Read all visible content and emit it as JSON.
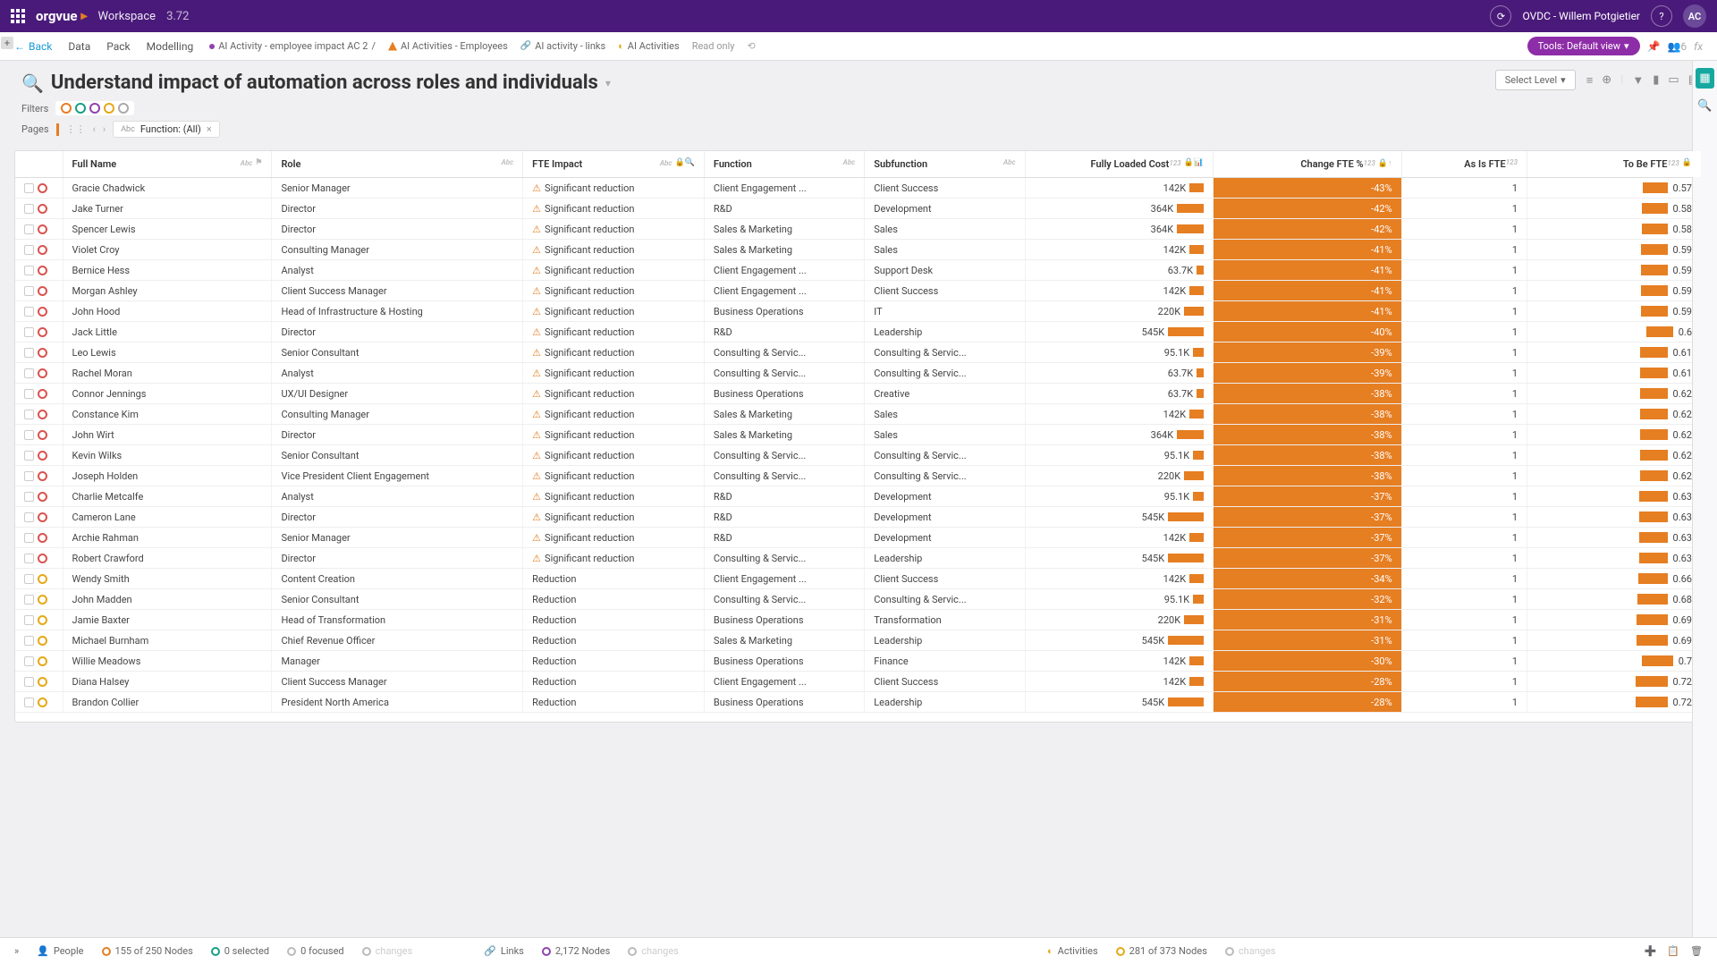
{
  "topbar": {
    "logo": "orgvue",
    "workspace": "Workspace",
    "version": "3.72",
    "user": "OVDC - Willem Potgietier",
    "avatar": "AC"
  },
  "nav": {
    "back": "Back",
    "tabs": [
      "Data",
      "Pack",
      "Modelling"
    ],
    "crumbs": [
      {
        "label": "AI Activity - employee impact AC 2",
        "cls": "purple"
      },
      {
        "label": "AI Activities - Employees",
        "cls": "orange"
      },
      {
        "label": "AI activity - links",
        "cls": "link"
      },
      {
        "label": "AI Activities",
        "cls": "yellow"
      }
    ],
    "readonly": "Read only",
    "tools": "Tools: Default view",
    "people_count": "6"
  },
  "page": {
    "title": "Understand impact of automation across roles and individuals",
    "filters_label": "Filters",
    "pages_label": "Pages",
    "pages_pill_abc": "Abc",
    "pages_pill": "Function: (All)",
    "select_level": "Select Level"
  },
  "columns": [
    {
      "label": "Full Name",
      "cls": "col-name",
      "type": "Abc",
      "icons": "⚑"
    },
    {
      "label": "Role",
      "cls": "col-role",
      "type": "Abc"
    },
    {
      "label": "FTE Impact",
      "cls": "col-fte",
      "type": "Abc",
      "icons": "🔒🔍"
    },
    {
      "label": "Function",
      "cls": "col-func",
      "type": "Abc"
    },
    {
      "label": "Subfunction",
      "cls": "col-subf",
      "type": "Abc"
    },
    {
      "label": "Fully Loaded Cost",
      "cls": "col-cost",
      "type": "123",
      "icons": "🔒📊"
    },
    {
      "label": "Change FTE %",
      "cls": "col-chg",
      "type": "123",
      "icons": "🔒↑"
    },
    {
      "label": "As Is FTE",
      "cls": "col-asis",
      "type": "123"
    },
    {
      "label": "To Be FTE",
      "cls": "col-tobe",
      "type": "123",
      "icons": "🔒"
    }
  ],
  "rows": [
    {
      "ring": "red",
      "name": "Gracie Chadwick",
      "role": "Senior Manager",
      "impact": "Significant reduction",
      "warn": true,
      "func": "Client Engagement ...",
      "subf": "Client Success",
      "cost": "142K",
      "chg": "-43%",
      "asis": "1",
      "tobe": "0.57"
    },
    {
      "ring": "red",
      "name": "Jake Turner",
      "role": "Director",
      "impact": "Significant reduction",
      "warn": true,
      "func": "R&D",
      "subf": "Development",
      "cost": "364K",
      "chg": "-42%",
      "asis": "1",
      "tobe": "0.58"
    },
    {
      "ring": "red",
      "name": "Spencer Lewis",
      "role": "Director",
      "impact": "Significant reduction",
      "warn": true,
      "func": "Sales & Marketing",
      "subf": "Sales",
      "cost": "364K",
      "chg": "-42%",
      "asis": "1",
      "tobe": "0.58"
    },
    {
      "ring": "red",
      "name": "Violet Croy",
      "role": "Consulting Manager",
      "impact": "Significant reduction",
      "warn": true,
      "func": "Sales & Marketing",
      "subf": "Sales",
      "cost": "142K",
      "chg": "-41%",
      "asis": "1",
      "tobe": "0.59"
    },
    {
      "ring": "red",
      "name": "Bernice Hess",
      "role": "Analyst",
      "impact": "Significant reduction",
      "warn": true,
      "func": "Client Engagement ...",
      "subf": "Support Desk",
      "cost": "63.7K",
      "chg": "-41%",
      "asis": "1",
      "tobe": "0.59"
    },
    {
      "ring": "red",
      "name": "Morgan Ashley",
      "role": "Client Success Manager",
      "impact": "Significant reduction",
      "warn": true,
      "func": "Client Engagement ...",
      "subf": "Client Success",
      "cost": "142K",
      "chg": "-41%",
      "asis": "1",
      "tobe": "0.59"
    },
    {
      "ring": "red",
      "name": "John Hood",
      "role": "Head of Infrastructure & Hosting",
      "impact": "Significant reduction",
      "warn": true,
      "func": "Business Operations",
      "subf": "IT",
      "cost": "220K",
      "chg": "-41%",
      "asis": "1",
      "tobe": "0.59"
    },
    {
      "ring": "red",
      "name": "Jack Little",
      "role": "Director",
      "impact": "Significant reduction",
      "warn": true,
      "func": "R&D",
      "subf": "Leadership",
      "cost": "545K",
      "chg": "-40%",
      "asis": "1",
      "tobe": "0.6"
    },
    {
      "ring": "red",
      "name": "Leo Lewis",
      "role": "Senior Consultant",
      "impact": "Significant reduction",
      "warn": true,
      "func": "Consulting & Servic...",
      "subf": "Consulting & Servic...",
      "cost": "95.1K",
      "chg": "-39%",
      "asis": "1",
      "tobe": "0.61"
    },
    {
      "ring": "red",
      "name": "Rachel Moran",
      "role": "Analyst",
      "impact": "Significant reduction",
      "warn": true,
      "func": "Consulting & Servic...",
      "subf": "Consulting & Servic...",
      "cost": "63.7K",
      "chg": "-39%",
      "asis": "1",
      "tobe": "0.61"
    },
    {
      "ring": "red",
      "name": "Connor Jennings",
      "role": "UX/UI Designer",
      "impact": "Significant reduction",
      "warn": true,
      "func": "Business Operations",
      "subf": "Creative",
      "cost": "63.7K",
      "chg": "-38%",
      "asis": "1",
      "tobe": "0.62"
    },
    {
      "ring": "red",
      "name": "Constance Kim",
      "role": "Consulting Manager",
      "impact": "Significant reduction",
      "warn": true,
      "func": "Sales & Marketing",
      "subf": "Sales",
      "cost": "142K",
      "chg": "-38%",
      "asis": "1",
      "tobe": "0.62"
    },
    {
      "ring": "red",
      "name": "John Wirt",
      "role": "Director",
      "impact": "Significant reduction",
      "warn": true,
      "func": "Sales & Marketing",
      "subf": "Sales",
      "cost": "364K",
      "chg": "-38%",
      "asis": "1",
      "tobe": "0.62"
    },
    {
      "ring": "red",
      "name": "Kevin Wilks",
      "role": "Senior Consultant",
      "impact": "Significant reduction",
      "warn": true,
      "func": "Consulting & Servic...",
      "subf": "Consulting & Servic...",
      "cost": "95.1K",
      "chg": "-38%",
      "asis": "1",
      "tobe": "0.62"
    },
    {
      "ring": "red",
      "name": "Joseph Holden",
      "role": "Vice President Client Engagement",
      "impact": "Significant reduction",
      "warn": true,
      "func": "Consulting & Servic...",
      "subf": "Consulting & Servic...",
      "cost": "220K",
      "chg": "-38%",
      "asis": "1",
      "tobe": "0.62"
    },
    {
      "ring": "red",
      "name": "Charlie Metcalfe",
      "role": "Analyst",
      "impact": "Significant reduction",
      "warn": true,
      "func": "R&D",
      "subf": "Development",
      "cost": "95.1K",
      "chg": "-37%",
      "asis": "1",
      "tobe": "0.63"
    },
    {
      "ring": "red",
      "name": "Cameron Lane",
      "role": "Director",
      "impact": "Significant reduction",
      "warn": true,
      "func": "R&D",
      "subf": "Development",
      "cost": "545K",
      "chg": "-37%",
      "asis": "1",
      "tobe": "0.63"
    },
    {
      "ring": "red",
      "name": "Archie Rahman",
      "role": "Senior Manager",
      "impact": "Significant reduction",
      "warn": true,
      "func": "R&D",
      "subf": "Development",
      "cost": "142K",
      "chg": "-37%",
      "asis": "1",
      "tobe": "0.63"
    },
    {
      "ring": "red",
      "name": "Robert Crawford",
      "role": "Director",
      "impact": "Significant reduction",
      "warn": true,
      "func": "Consulting & Servic...",
      "subf": "Leadership",
      "cost": "545K",
      "chg": "-37%",
      "asis": "1",
      "tobe": "0.63"
    },
    {
      "ring": "yellow",
      "name": "Wendy Smith",
      "role": "Content Creation",
      "impact": "Reduction",
      "warn": false,
      "func": "Client Engagement ...",
      "subf": "Client Success",
      "cost": "142K",
      "chg": "-34%",
      "asis": "1",
      "tobe": "0.66"
    },
    {
      "ring": "yellow",
      "name": "John Madden",
      "role": "Senior Consultant",
      "impact": "Reduction",
      "warn": false,
      "func": "Consulting & Servic...",
      "subf": "Consulting & Servic...",
      "cost": "95.1K",
      "chg": "-32%",
      "asis": "1",
      "tobe": "0.68"
    },
    {
      "ring": "yellow",
      "name": "Jamie Baxter",
      "role": "Head of Transformation",
      "impact": "Reduction",
      "warn": false,
      "func": "Business Operations",
      "subf": "Transformation",
      "cost": "220K",
      "chg": "-31%",
      "asis": "1",
      "tobe": "0.69"
    },
    {
      "ring": "yellow",
      "name": "Michael Burnham",
      "role": "Chief Revenue Officer",
      "impact": "Reduction",
      "warn": false,
      "func": "Sales & Marketing",
      "subf": "Leadership",
      "cost": "545K",
      "chg": "-31%",
      "asis": "1",
      "tobe": "0.69"
    },
    {
      "ring": "yellow",
      "name": "Willie Meadows",
      "role": "Manager",
      "impact": "Reduction",
      "warn": false,
      "func": "Business Operations",
      "subf": "Finance",
      "cost": "142K",
      "chg": "-30%",
      "asis": "1",
      "tobe": "0.7"
    },
    {
      "ring": "yellow",
      "name": "Diana Halsey",
      "role": "Client Success Manager",
      "impact": "Reduction",
      "warn": false,
      "func": "Client Engagement ...",
      "subf": "Client Success",
      "cost": "142K",
      "chg": "-28%",
      "asis": "1",
      "tobe": "0.72"
    },
    {
      "ring": "yellow",
      "name": "Brandon Collier",
      "role": "President North America",
      "impact": "Reduction",
      "warn": false,
      "func": "Business Operations",
      "subf": "Leadership",
      "cost": "545K",
      "chg": "-28%",
      "asis": "1",
      "tobe": "0.72"
    }
  ],
  "footer": {
    "people": "People",
    "nodes1": "155 of 250 Nodes",
    "selected": "0 selected",
    "focused": "0 focused",
    "changes1": "changes",
    "links": "Links",
    "nodes2": "2,172 Nodes",
    "changes2": "changes",
    "activities": "Activities",
    "nodes3": "281 of 373 Nodes",
    "changes3": "changes"
  }
}
